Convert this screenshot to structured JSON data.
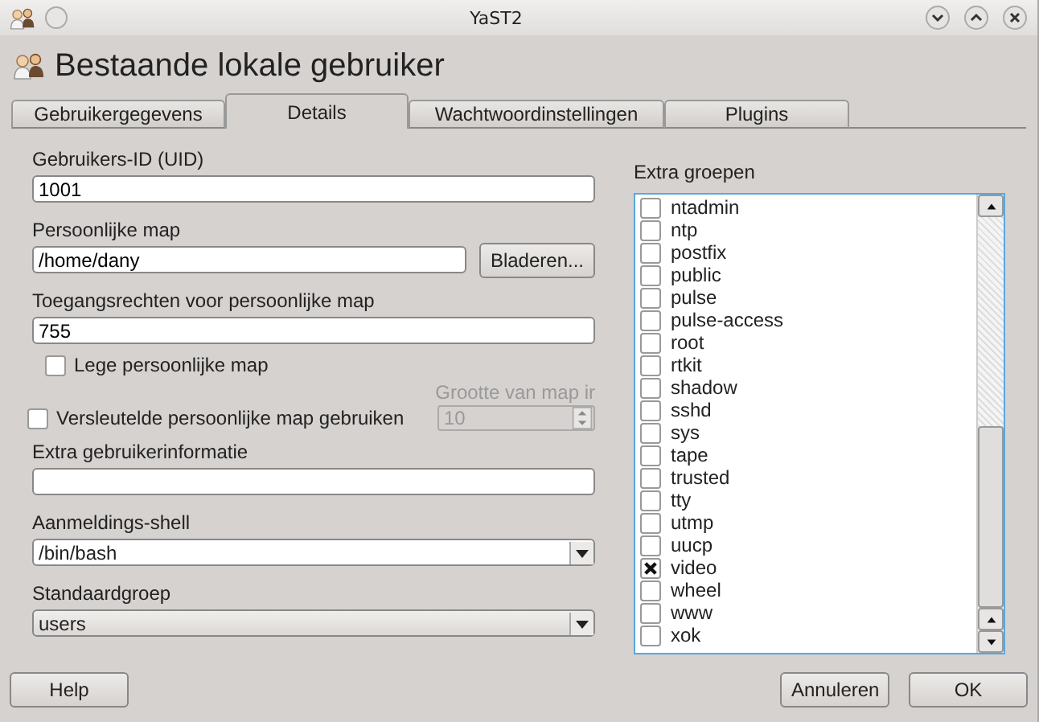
{
  "window": {
    "title": "YaST2"
  },
  "heading": "Bestaande lokale gebruiker",
  "tabs": [
    {
      "label": "Gebruikergegevens",
      "selected": false
    },
    {
      "label": "Details",
      "selected": true
    },
    {
      "label": "Wachtwoordinstellingen",
      "selected": false
    },
    {
      "label": "Plugins",
      "selected": false
    }
  ],
  "uid": {
    "label": "Gebruikers-ID (UID)",
    "value": "1001"
  },
  "home": {
    "label": "Persoonlijke map",
    "value": "/home/dany",
    "button": "Bladeren..."
  },
  "permissions": {
    "label": "Toegangsrechten voor persoonlijke map",
    "value": "755"
  },
  "empty_home": {
    "label": "Lege persoonlijke map",
    "checked": false
  },
  "encrypted_home": {
    "label": "Versleutelde persoonlijke map gebruiken",
    "checked": false
  },
  "size": {
    "label": "Grootte van map ir",
    "value": "10",
    "disabled": true
  },
  "extra_info": {
    "label": "Extra gebruikerinformatie"
  },
  "shell": {
    "label": "Aanmeldings-shell",
    "value": "/bin/bash"
  },
  "default_group": {
    "label": "Standaardgroep",
    "value": "users"
  },
  "groups": {
    "label": "Extra groepen",
    "items": [
      {
        "name": "ntadmin",
        "checked": false
      },
      {
        "name": "ntp",
        "checked": false
      },
      {
        "name": "postfix",
        "checked": false
      },
      {
        "name": "public",
        "checked": false
      },
      {
        "name": "pulse",
        "checked": false
      },
      {
        "name": "pulse-access",
        "checked": false
      },
      {
        "name": "root",
        "checked": false
      },
      {
        "name": "rtkit",
        "checked": false
      },
      {
        "name": "shadow",
        "checked": false
      },
      {
        "name": "sshd",
        "checked": false
      },
      {
        "name": "sys",
        "checked": false
      },
      {
        "name": "tape",
        "checked": false
      },
      {
        "name": "trusted",
        "checked": false
      },
      {
        "name": "tty",
        "checked": false
      },
      {
        "name": "utmp",
        "checked": false
      },
      {
        "name": "uucp",
        "checked": false
      },
      {
        "name": "video",
        "checked": true
      },
      {
        "name": "wheel",
        "checked": false
      },
      {
        "name": "www",
        "checked": false
      },
      {
        "name": "xok",
        "checked": false
      }
    ]
  },
  "buttons": {
    "help": "Help",
    "cancel": "Annuleren",
    "ok": "OK"
  }
}
